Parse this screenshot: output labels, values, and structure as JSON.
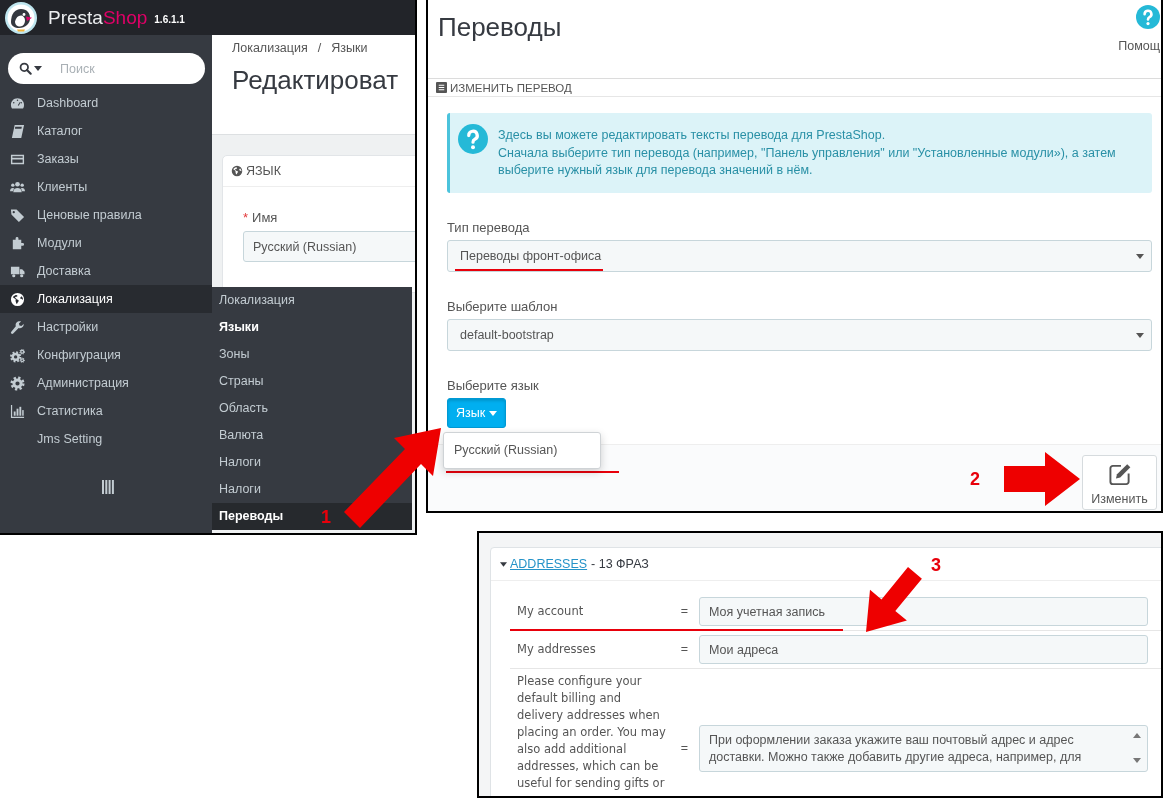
{
  "backoffice_screenshot": {
    "brand": {
      "name_first": "Presta",
      "name_second": "Shop",
      "version": "1.6.1.1"
    },
    "search": {
      "placeholder": "Поиск"
    },
    "sidebar": {
      "items": [
        {
          "label": "Dashboard",
          "selected": false
        },
        {
          "label": "Каталог",
          "selected": false
        },
        {
          "label": "Заказы",
          "selected": false
        },
        {
          "label": "Клиенты",
          "selected": false
        },
        {
          "label": "Ценовые правила",
          "selected": false
        },
        {
          "label": "Модули",
          "selected": false
        },
        {
          "label": "Доставка",
          "selected": false
        },
        {
          "label": "Локализация",
          "selected": true
        },
        {
          "label": "Настройки",
          "selected": false
        },
        {
          "label": "Конфигурация",
          "selected": false
        },
        {
          "label": "Администрация",
          "selected": false
        },
        {
          "label": "Статистика",
          "selected": false
        },
        {
          "label": "Jms Setting",
          "selected": false
        }
      ]
    },
    "submenu": {
      "items": [
        {
          "label": "Локализация",
          "selected": false,
          "highlighted": false
        },
        {
          "label": "Языки",
          "selected": true,
          "highlighted": false
        },
        {
          "label": "Зоны",
          "selected": false,
          "highlighted": false
        },
        {
          "label": "Страны",
          "selected": false,
          "highlighted": false
        },
        {
          "label": "Область",
          "selected": false,
          "highlighted": false
        },
        {
          "label": "Валюта",
          "selected": false,
          "highlighted": false
        },
        {
          "label": "Налоги",
          "selected": false,
          "highlighted": false
        },
        {
          "label": "Налоги",
          "selected": false,
          "highlighted": false
        },
        {
          "label": "Переводы",
          "selected": true,
          "highlighted": true
        }
      ]
    },
    "breadcrumb": {
      "items": [
        "Локализация",
        "Языки"
      ],
      "separator": "/"
    },
    "page_title": "Редактироват",
    "panel": {
      "title": "ЯЗЫК",
      "field": {
        "required_mark": "*",
        "label": "Имя",
        "value": "Русский (Russian)"
      }
    }
  },
  "translations_screenshot": {
    "page_title": "Переводы",
    "help": {
      "label": "Помощ"
    },
    "panel": {
      "title": "ИЗМЕНИТЬ ПЕРЕВОД",
      "info": [
        "Здесь вы можете редактировать тексты перевода для PrestaShop.",
        "Сначала выберите тип перевода (например, \"Панель управления\" или \"Установленные модули»), а затем выберите нужный язык для перевода значений в нём."
      ],
      "fields": [
        {
          "kind": "select",
          "label": "Тип перевода",
          "value": "Переводы фронт-офиса"
        },
        {
          "kind": "select",
          "label": "Выберите шаблон",
          "value": "default-bootstrap"
        },
        {
          "kind": "dropdown",
          "label": "Выберите язык",
          "button": "Язык",
          "expanded": true,
          "options": [
            "Русский (Russian)"
          ]
        }
      ],
      "footer_button": "Изменить"
    }
  },
  "phrases_screenshot": {
    "group": {
      "name": "ADDRESSES",
      "count": "- 13 ФРАЗ",
      "expanded": true
    },
    "rows": [
      {
        "kind": "input",
        "source": "My account",
        "equals": "=",
        "translation": "Моя учетная запись"
      },
      {
        "kind": "input",
        "source": "My addresses",
        "equals": "=",
        "translation": "Мои адреса"
      },
      {
        "kind": "textarea",
        "source": "Please configure your default billing and delivery addresses when placing an order. You may also add additional addresses, which can be useful for sending gifts or",
        "equals": "=",
        "translation": "При оформлении заказа укажите ваш почтовый адрес и адрес доставки. Можно также добавить другие адреса, например, для"
      }
    ]
  },
  "annotations": [
    {
      "label": "1"
    },
    {
      "label": "2"
    },
    {
      "label": "3"
    }
  ]
}
